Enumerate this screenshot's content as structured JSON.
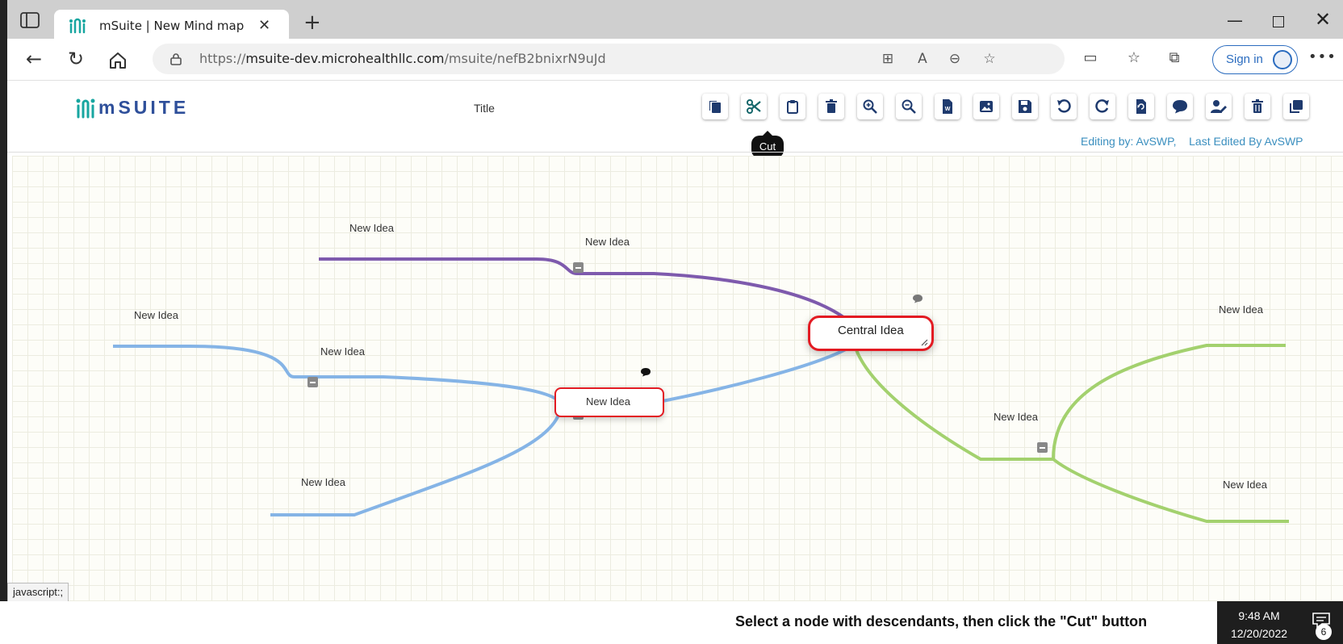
{
  "browser": {
    "tab_title": "mSuite | New Mind map",
    "url_host_prefix": "https://",
    "url_host": "msuite-dev.microhealthllc.com",
    "url_path": "/msuite/nefB2bnixrN9uJd",
    "sign_in_label": "Sign in"
  },
  "app": {
    "logo_text": "mSUITE",
    "doc_title": "Title",
    "tooltip": "Cut",
    "editing_by": "Editing by: AvSWP,",
    "last_edited": "Last Edited By AvSWP",
    "toolbar": [
      {
        "name": "copy-button",
        "icon": "copy-icon"
      },
      {
        "name": "cut-button",
        "icon": "scissors-icon"
      },
      {
        "name": "paste-button",
        "icon": "clipboard-icon"
      },
      {
        "name": "delete-node-button",
        "icon": "trash-icon"
      },
      {
        "name": "zoom-in-button",
        "icon": "zoom-in-icon"
      },
      {
        "name": "zoom-out-button",
        "icon": "zoom-out-icon"
      },
      {
        "name": "export-word-button",
        "icon": "word-file-icon"
      },
      {
        "name": "export-image-button",
        "icon": "image-icon"
      },
      {
        "name": "save-button",
        "icon": "save-icon"
      },
      {
        "name": "undo-button",
        "icon": "undo-icon"
      },
      {
        "name": "redo-button",
        "icon": "redo-icon"
      },
      {
        "name": "reset-button",
        "icon": "reset-file-icon"
      },
      {
        "name": "comment-button",
        "icon": "comment-icon"
      },
      {
        "name": "edit-user-button",
        "icon": "user-edit-icon"
      },
      {
        "name": "delete-map-button",
        "icon": "trash-alt-icon"
      },
      {
        "name": "duplicate-button",
        "icon": "clone-icon"
      }
    ],
    "colors": {
      "accent": "#1e3a6e",
      "purple_branch": "#7e5aad",
      "blue_branch": "#85b4e6",
      "green_branch": "#a3d16e",
      "selection": "#e31b23"
    }
  },
  "mindmap": {
    "central": "Central Idea",
    "nodes": [
      {
        "id": "p1",
        "label": "New Idea"
      },
      {
        "id": "p2",
        "label": "New Idea"
      },
      {
        "id": "b1",
        "label": "New Idea"
      },
      {
        "id": "b2",
        "label": "New Idea"
      },
      {
        "id": "b3",
        "label": "New Idea"
      },
      {
        "id": "bsel",
        "label": "New Idea"
      },
      {
        "id": "g1",
        "label": "New Idea"
      },
      {
        "id": "g2",
        "label": "New Idea"
      },
      {
        "id": "g3",
        "label": "New Idea"
      }
    ]
  },
  "status_url": "javascript:;",
  "instruction": "Select a node with descendants, then click the \"Cut\" button",
  "taskbar": {
    "time": "9:48 AM",
    "date": "12/20/2022",
    "notifications": "6"
  }
}
